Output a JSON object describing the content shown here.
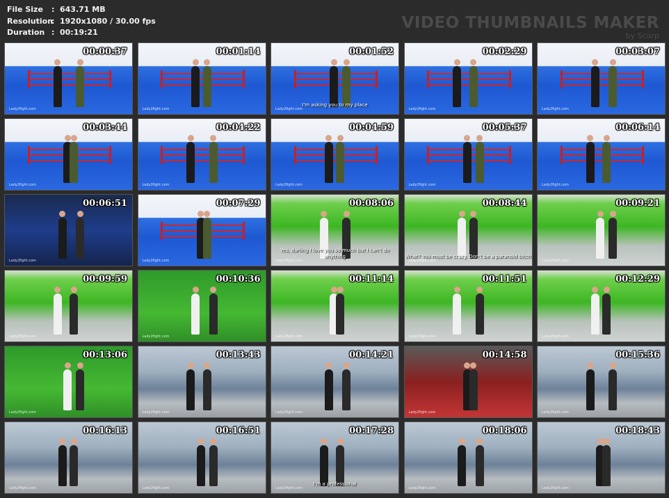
{
  "info": {
    "file_size_label": "File Size",
    "file_size": "643.71 MB",
    "resolution_label": "Resolution",
    "resolution": "1920x1080 / 30.00 fps",
    "duration_label": "Duration",
    "duration": "00:19:21",
    "separator": ":"
  },
  "watermark": {
    "title": "VIDEO THUMBNAILS MAKER",
    "sub": "by Scorp"
  },
  "thumbnails": [
    {
      "time": "00:00:37",
      "scene": "blue",
      "subtitle": "",
      "logo": "Lady2fight.com"
    },
    {
      "time": "00:01:14",
      "scene": "blue",
      "subtitle": "",
      "logo": "Lady2fight.com"
    },
    {
      "time": "00:01:52",
      "scene": "blue",
      "subtitle": "I'm asking you to my place",
      "logo": "Lady2fight.com"
    },
    {
      "time": "00:02:29",
      "scene": "blue",
      "subtitle": "",
      "logo": "Lady2fight.com"
    },
    {
      "time": "00:03:07",
      "scene": "blue",
      "subtitle": "",
      "logo": "Lady2fight.com"
    },
    {
      "time": "00:03:44",
      "scene": "blue",
      "subtitle": "",
      "logo": "Lady2fight.com"
    },
    {
      "time": "00:04:22",
      "scene": "blue",
      "subtitle": "",
      "logo": "Lady2fight.com"
    },
    {
      "time": "00:04:59",
      "scene": "blue",
      "subtitle": "",
      "logo": "Lady2fight.com"
    },
    {
      "time": "00:05:37",
      "scene": "blue",
      "subtitle": "",
      "logo": "Lady2fight.com"
    },
    {
      "time": "00:06:14",
      "scene": "blue",
      "subtitle": "",
      "logo": "Lady2fight.com"
    },
    {
      "time": "00:06:51",
      "scene": "dark",
      "subtitle": "",
      "logo": "Lady2fight.com"
    },
    {
      "time": "00:07:29",
      "scene": "blue",
      "subtitle": "",
      "logo": "Lady2fight.com"
    },
    {
      "time": "00:08:06",
      "scene": "green",
      "subtitle": "Yes, darling I love you so much but I can't do anything",
      "logo": "Lady2fight.com"
    },
    {
      "time": "00:08:44",
      "scene": "green",
      "subtitle": "What? You must be crazy. Don't be a paranoid bitch",
      "logo": "Lady2fight.com"
    },
    {
      "time": "00:09:21",
      "scene": "green",
      "subtitle": "",
      "logo": "Lady2fight.com"
    },
    {
      "time": "00:09:59",
      "scene": "green",
      "subtitle": "",
      "logo": "Lady2fight.com"
    },
    {
      "time": "00:10:36",
      "scene": "closegreen",
      "subtitle": "",
      "logo": "Lady2fight.com"
    },
    {
      "time": "00:11:14",
      "scene": "green",
      "subtitle": "",
      "logo": "Lady2fight.com"
    },
    {
      "time": "00:11:51",
      "scene": "green",
      "subtitle": "",
      "logo": "Lady2fight.com"
    },
    {
      "time": "00:12:29",
      "scene": "green",
      "subtitle": "",
      "logo": "Lady2fight.com"
    },
    {
      "time": "00:13:06",
      "scene": "closegreen",
      "subtitle": "",
      "logo": "Lady2fight.com"
    },
    {
      "time": "00:13:43",
      "scene": "office",
      "subtitle": "",
      "logo": "Lady2fight.com"
    },
    {
      "time": "00:14:21",
      "scene": "office",
      "subtitle": "",
      "logo": "Lady2fight.com"
    },
    {
      "time": "00:14:58",
      "scene": "red",
      "subtitle": "",
      "logo": "Lady2fight.com"
    },
    {
      "time": "00:15:36",
      "scene": "office",
      "subtitle": "",
      "logo": "Lady2fight.com"
    },
    {
      "time": "00:16:13",
      "scene": "office",
      "subtitle": "",
      "logo": "Lady2fight.com"
    },
    {
      "time": "00:16:51",
      "scene": "office",
      "subtitle": "",
      "logo": "Lady2fight.com"
    },
    {
      "time": "00:17:28",
      "scene": "office",
      "subtitle": "I'm a professional",
      "logo": "Lady2fight.com"
    },
    {
      "time": "00:18:06",
      "scene": "office",
      "subtitle": "",
      "logo": "Lady2fight.com"
    },
    {
      "time": "00:18:43",
      "scene": "office",
      "subtitle": "",
      "logo": "Lady2fight.com"
    }
  ]
}
